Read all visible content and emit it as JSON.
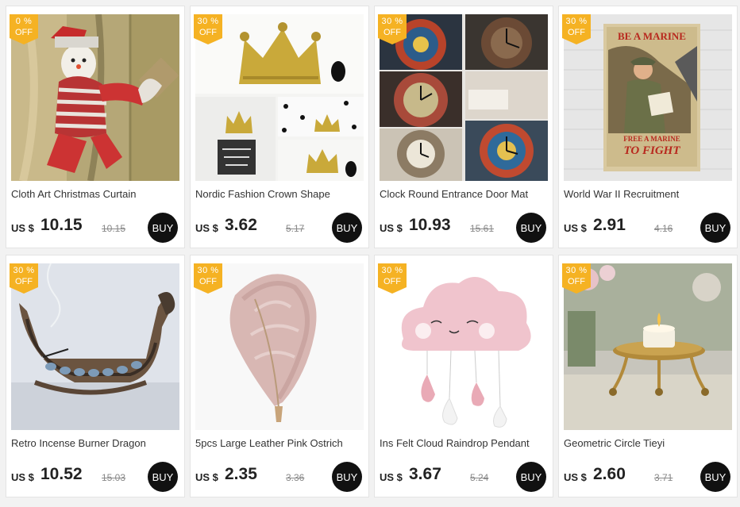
{
  "products": [
    {
      "discount_pct": "0 %",
      "discount_off": "OFF",
      "title": "Cloth Art Christmas Curtain",
      "currency": "US $",
      "price": "10.15",
      "old_price": "10.15",
      "buy_label": "BUY"
    },
    {
      "discount_pct": "30 %",
      "discount_off": "OFF",
      "title": "Nordic Fashion Crown Shape",
      "currency": "US $",
      "price": "3.62",
      "old_price": "5.17",
      "buy_label": "BUY"
    },
    {
      "discount_pct": "30 %",
      "discount_off": "OFF",
      "title": "Clock Round Entrance Door Mat",
      "currency": "US $",
      "price": "10.93",
      "old_price": "15.61",
      "buy_label": "BUY"
    },
    {
      "discount_pct": "30 %",
      "discount_off": "OFF",
      "title": "World War II Recruitment",
      "currency": "US $",
      "price": "2.91",
      "old_price": "4.16",
      "buy_label": "BUY"
    },
    {
      "discount_pct": "30 %",
      "discount_off": "OFF",
      "title": "Retro Incense Burner Dragon",
      "currency": "US $",
      "price": "10.52",
      "old_price": "15.03",
      "buy_label": "BUY"
    },
    {
      "discount_pct": "30 %",
      "discount_off": "OFF",
      "title": "5pcs Large Leather Pink Ostrich",
      "currency": "US $",
      "price": "2.35",
      "old_price": "3.36",
      "buy_label": "BUY"
    },
    {
      "discount_pct": "30 %",
      "discount_off": "OFF",
      "title": "Ins Felt Cloud Raindrop Pendant",
      "currency": "US $",
      "price": "3.67",
      "old_price": "5.24",
      "buy_label": "BUY"
    },
    {
      "discount_pct": "30 %",
      "discount_off": "OFF",
      "title": "Geometric Circle Tieyi",
      "currency": "US $",
      "price": "2.60",
      "old_price": "3.71",
      "buy_label": "BUY"
    }
  ],
  "poster": {
    "line1": "BE A MARINE",
    "line2": "FREE A MARINE",
    "line3": "TO FIGHT"
  },
  "colors": {
    "badge": "#f5b223",
    "buy_button": "#111111",
    "background": "#f2f2f2"
  }
}
